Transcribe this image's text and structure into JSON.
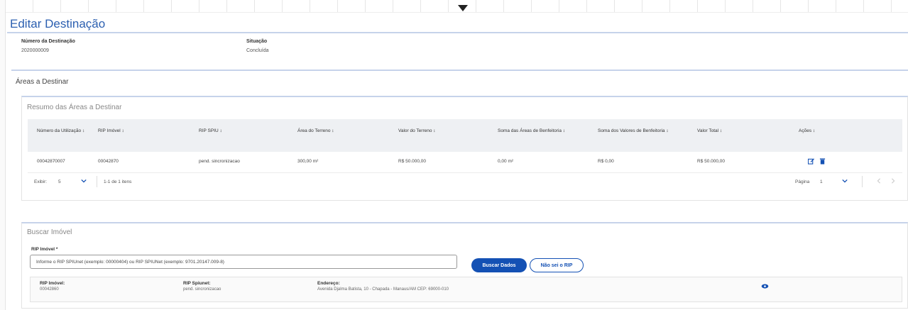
{
  "header": {
    "title": "Editar Destinação"
  },
  "details": {
    "numero_label": "Número da Destinação",
    "numero_value": "2020000009",
    "situacao_label": "Situação",
    "situacao_value": "Concluída"
  },
  "areas_section": {
    "title": "Áreas a Destinar"
  },
  "resumo": {
    "title": "Resumo das Áreas a Destinar",
    "columns": [
      "Número da Utilização ↕",
      "RIP Imóvel ↕",
      "RIP SPIU ↕",
      "Área do Terreno ↕",
      "Valor do Terreno ↕",
      "Soma das Áreas de Benfeitoria ↕",
      "Soma dos Valores de Benfeitoria ↕",
      "Valor Total ↕",
      "Ações ↕"
    ],
    "rows": [
      {
        "numero": "00042870007",
        "rip_imovel": "00042870",
        "rip_spiu": "pend. sincronizacao",
        "area_terreno": "300,00 m²",
        "valor_terreno": "R$ 50.000,00",
        "soma_areas": "0,00 m²",
        "soma_valores": "R$ 0,00",
        "valor_total": "R$ 50.000,00"
      }
    ],
    "pagination": {
      "exibir_label": "Exibir:",
      "per_page": "5",
      "range_text": "1-1 de 1 itens",
      "pagina_label": "Página",
      "page": "1"
    }
  },
  "buscar": {
    "title": "Buscar Imóvel",
    "rip_label": "RIP Imóvel *",
    "rip_placeholder": "Informe o RIP SPIUnet (exemplo: 00000404) ou RIP SPIUNet (exemplo: 9701.20147.009-8)",
    "buscar_button": "Buscar Dados",
    "nao_sei_button": "Não sei o RIP",
    "result": {
      "rip_imovel_label": "RIP Imóvel:",
      "rip_imovel_value": "00042860",
      "rip_spiunet_label": "RIP Spiunet:",
      "rip_spiunet_value": "pend. sincronizacao",
      "endereco_label": "Endereço:",
      "endereco_value": "Avenida Djalma Batista, 10 - Chapada - Manaus/AM CEP: 69000-010"
    }
  },
  "colors": {
    "accent": "#1451b4",
    "title_blue": "#2b5fb0",
    "rule_blue": "#c6d3ea",
    "table_header_bg": "#eef0f3"
  },
  "icons": [
    "collapse-caret-icon",
    "edit-icon",
    "trash-icon",
    "chevron-down-icon",
    "chevron-left-icon",
    "chevron-right-icon",
    "eye-icon"
  ]
}
